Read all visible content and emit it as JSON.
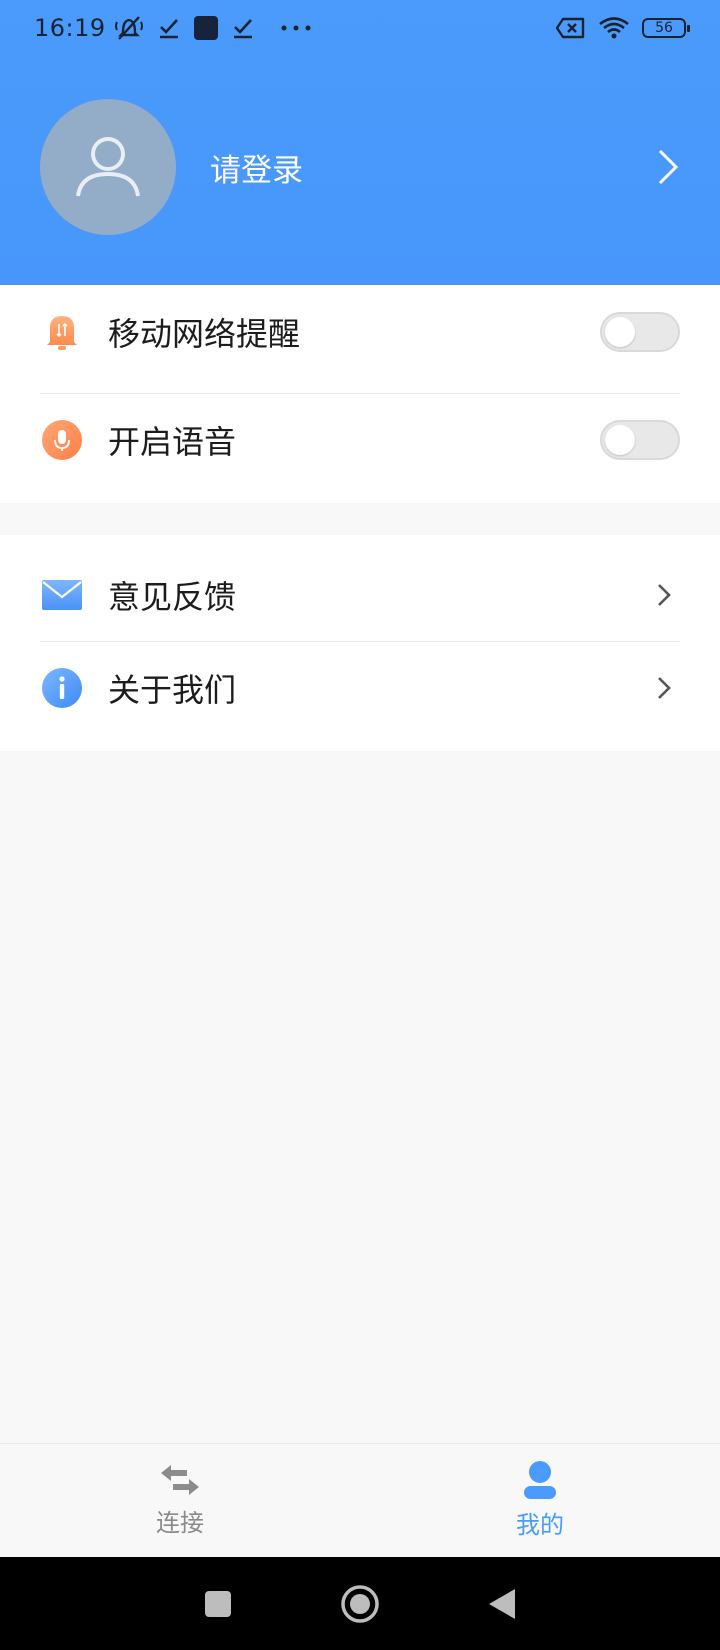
{
  "status_bar": {
    "time": "16:19",
    "left_icons": [
      "mute-bell-icon",
      "check-icon",
      "app-square-icon",
      "check-icon",
      "more-dots-icon"
    ],
    "right_icons": [
      "no-sim-icon",
      "wifi-icon",
      "battery-icon"
    ],
    "battery_level": "56"
  },
  "profile": {
    "login_label": "请登录"
  },
  "settings": {
    "toggles": [
      {
        "label": "移动网络提醒",
        "icon": "bell-icon",
        "enabled": false
      },
      {
        "label": "开启语音",
        "icon": "microphone-icon",
        "enabled": false
      }
    ],
    "links": [
      {
        "label": "意见反馈",
        "icon": "mail-icon"
      },
      {
        "label": "关于我们",
        "icon": "info-icon"
      }
    ]
  },
  "tabbar": {
    "tabs": [
      {
        "label": "连接",
        "icon": "swap-arrows-icon",
        "active": false
      },
      {
        "label": "我的",
        "icon": "user-icon",
        "active": true
      }
    ]
  },
  "colors": {
    "header": "#4a9bfb",
    "accent": "#4a9bfb",
    "inactive_tab": "#8a8a8a",
    "toggle_off": "#e8e8e8"
  }
}
